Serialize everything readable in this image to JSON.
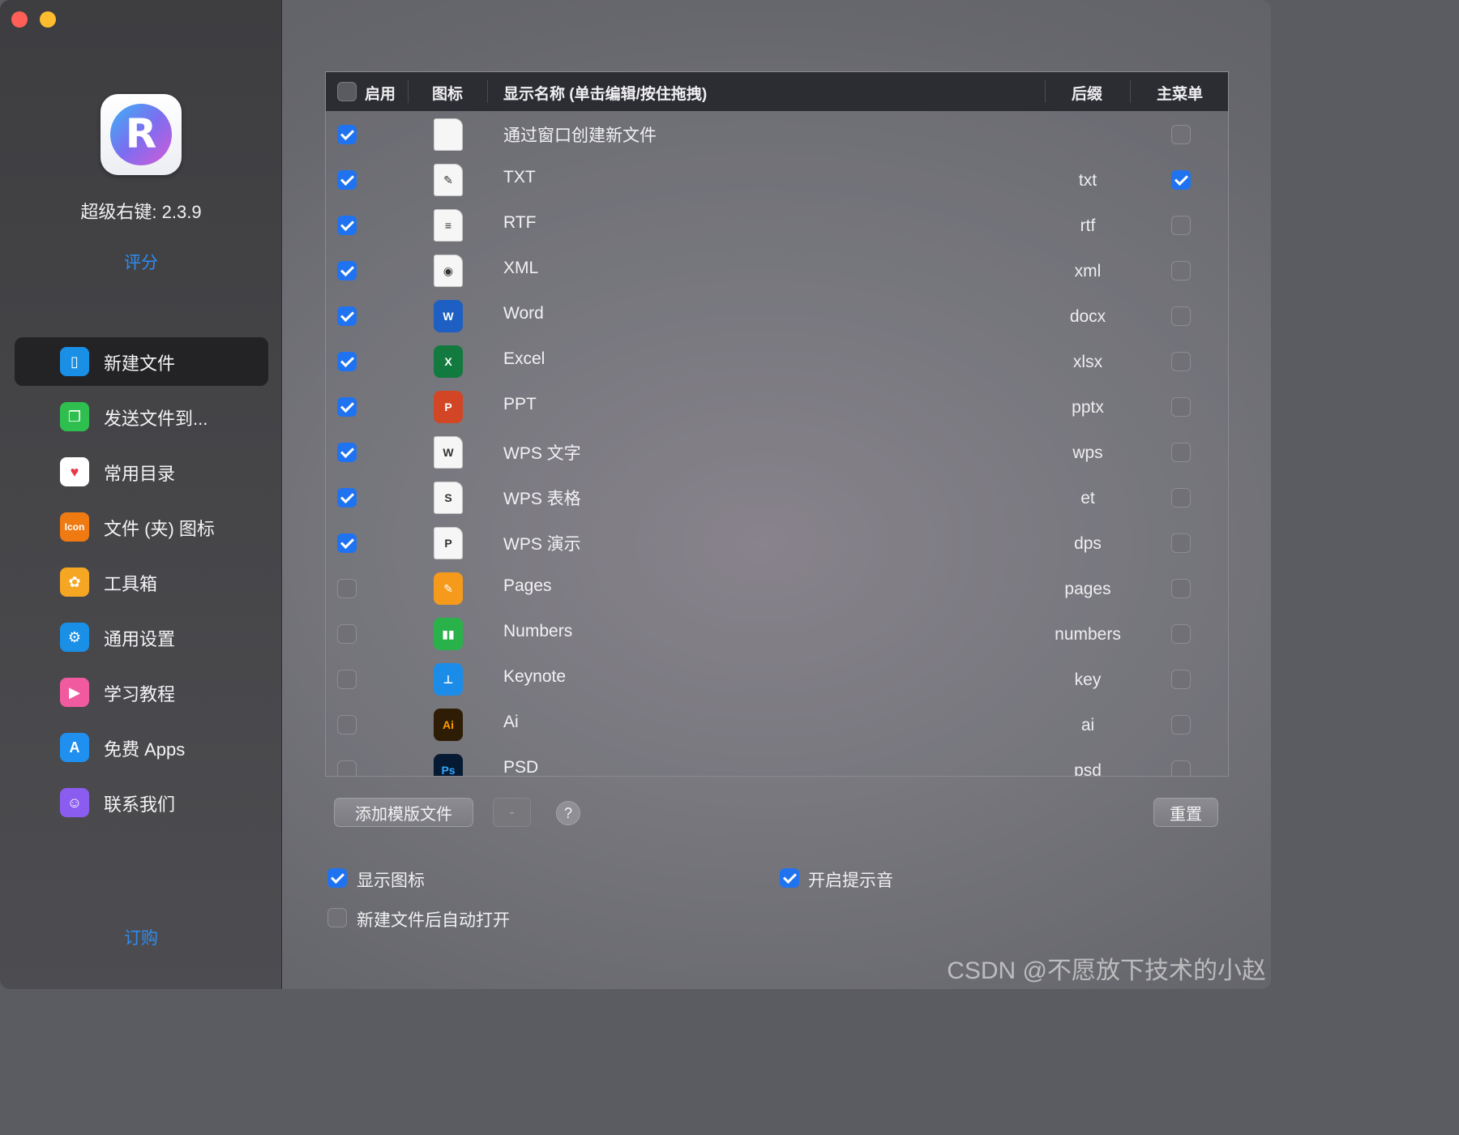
{
  "app": {
    "name": "超级右键: 2.3.9",
    "icon_letter": "R",
    "rate": "评分",
    "subscribe": "订购"
  },
  "sidebar": {
    "items": [
      {
        "label": "新建文件",
        "icon": "new-file-icon",
        "color": "#1a8fe6",
        "glyph": "▯",
        "active": true
      },
      {
        "label": "发送文件到...",
        "icon": "send-file-icon",
        "color": "#2ebf4f",
        "glyph": "❐",
        "active": false
      },
      {
        "label": "常用目录",
        "icon": "heart-icon",
        "color": "#ffffff",
        "glyph": "♥",
        "active": false
      },
      {
        "label": "文件 (夹) 图标",
        "icon": "icon-badge-icon",
        "color": "#f07a12",
        "glyph": "Icon",
        "active": false
      },
      {
        "label": "工具箱",
        "icon": "toolbox-icon",
        "color": "#f5a623",
        "glyph": "✿",
        "active": false
      },
      {
        "label": "通用设置",
        "icon": "gear-icon",
        "color": "#1a8fe6",
        "glyph": "⚙",
        "active": false
      },
      {
        "label": "学习教程",
        "icon": "tutorial-icon",
        "color": "#f25aa0",
        "glyph": "▶",
        "active": false
      },
      {
        "label": "免费 Apps",
        "icon": "app-store-icon",
        "color": "#1f8ff0",
        "glyph": "A",
        "active": false
      },
      {
        "label": "联系我们",
        "icon": "contact-icon",
        "color": "#8a5cf0",
        "glyph": "☺",
        "active": false
      }
    ]
  },
  "table": {
    "headers": {
      "enable": "启用",
      "icon": "图标",
      "name": "显示名称 (单击编辑/按住拖拽)",
      "suffix": "后缀",
      "main_menu": "主菜单"
    },
    "rows": [
      {
        "enabled": true,
        "icon": "blank-document-icon",
        "glyph": "",
        "icon_style": "doc",
        "name": "通过窗口创建新文件",
        "suffix": "",
        "main_menu": false
      },
      {
        "enabled": true,
        "icon": "text-document-icon",
        "glyph": "✎",
        "icon_style": "doc",
        "name": "TXT",
        "suffix": "txt",
        "main_menu": true
      },
      {
        "enabled": true,
        "icon": "rtf-document-icon",
        "glyph": "≡",
        "icon_style": "doc",
        "name": "RTF",
        "suffix": "rtf",
        "main_menu": false
      },
      {
        "enabled": true,
        "icon": "xml-document-icon",
        "glyph": "◉",
        "icon_style": "doc",
        "name": "XML",
        "suffix": "xml",
        "main_menu": false
      },
      {
        "enabled": true,
        "icon": "word-icon",
        "glyph": "W",
        "icon_style": "#1d5fc2",
        "name": "Word",
        "suffix": "docx",
        "main_menu": false
      },
      {
        "enabled": true,
        "icon": "excel-icon",
        "glyph": "X",
        "icon_style": "#137a3f",
        "name": "Excel",
        "suffix": "xlsx",
        "main_menu": false
      },
      {
        "enabled": true,
        "icon": "powerpoint-icon",
        "glyph": "P",
        "icon_style": "#d24625",
        "name": "PPT",
        "suffix": "pptx",
        "main_menu": false
      },
      {
        "enabled": true,
        "icon": "wps-writer-icon",
        "glyph": "W",
        "icon_style": "doc",
        "name": "WPS 文字",
        "suffix": "wps",
        "main_menu": false
      },
      {
        "enabled": true,
        "icon": "wps-spreadsheet-icon",
        "glyph": "S",
        "icon_style": "doc",
        "name": "WPS 表格",
        "suffix": "et",
        "main_menu": false
      },
      {
        "enabled": true,
        "icon": "wps-presentation-icon",
        "glyph": "P",
        "icon_style": "doc",
        "name": "WPS 演示",
        "suffix": "dps",
        "main_menu": false
      },
      {
        "enabled": false,
        "icon": "pages-icon",
        "glyph": "✎",
        "icon_style": "#f59a1b",
        "name": "Pages",
        "suffix": "pages",
        "main_menu": false
      },
      {
        "enabled": false,
        "icon": "numbers-icon",
        "glyph": "▮▮",
        "icon_style": "#29b24a",
        "name": "Numbers",
        "suffix": "numbers",
        "main_menu": false
      },
      {
        "enabled": false,
        "icon": "keynote-icon",
        "glyph": "⊥",
        "icon_style": "#1b8de8",
        "name": "Keynote",
        "suffix": "key",
        "main_menu": false
      },
      {
        "enabled": false,
        "icon": "illustrator-icon",
        "glyph": "Ai",
        "icon_style": "#2e1d04",
        "name": "Ai",
        "suffix": "ai",
        "main_menu": false
      },
      {
        "enabled": false,
        "icon": "photoshop-icon",
        "glyph": "Ps",
        "icon_style": "#061a33",
        "name": "PSD",
        "suffix": "psd",
        "main_menu": false
      }
    ]
  },
  "buttons": {
    "add_template": "添加模版文件",
    "remove": "-",
    "help": "?",
    "reset": "重置"
  },
  "options": {
    "show_icon": {
      "label": "显示图标",
      "checked": true
    },
    "sound": {
      "label": "开启提示音",
      "checked": true
    },
    "auto_open": {
      "label": "新建文件后自动打开",
      "checked": false
    }
  },
  "watermark": "CSDN @不愿放下技术的小赵"
}
